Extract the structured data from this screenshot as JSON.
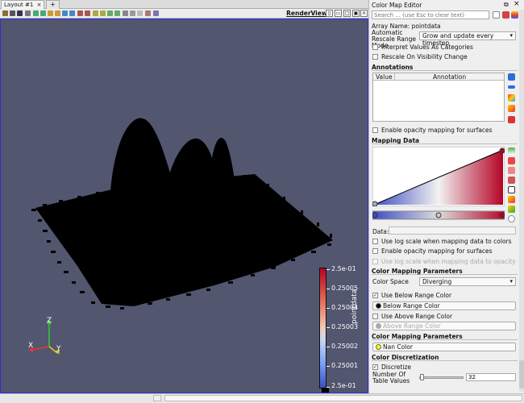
{
  "layout_tab": {
    "label": "Layout #1",
    "add_label": "+"
  },
  "view": {
    "title": "RenderView1",
    "background": "#52566f"
  },
  "colorbar": {
    "title": "pointdata",
    "labels": [
      "2.5e-01",
      "0.25005",
      "0.25004",
      "0.25003",
      "0.25002",
      "0.25001",
      "2.5e-01"
    ]
  },
  "axes": {
    "z": "Z",
    "x": "X",
    "y": "Y"
  },
  "panel": {
    "title": "Color Map Editor",
    "search_placeholder": "Search ... (use Esc to clear text)",
    "array_name": "Array Name: pointdata",
    "auto_rescale_label": "Automatic Rescale Range Mode",
    "auto_rescale_value": "Grow and update every timestep",
    "interpret_categories": "Interpret Values As Categories",
    "rescale_visibility": "Rescale On Visibility Change",
    "annotations_header": "Annotations",
    "annot_col_value": "Value",
    "annot_col_annotation": "Annotation",
    "enable_opacity_surfaces_1": "Enable opacity mapping for surfaces",
    "mapping_data_header": "Mapping Data",
    "data_label": "Data:",
    "log_scale_colors": "Use log scale when mapping data to colors",
    "enable_opacity_surfaces_2": "Enable opacity mapping for surfaces",
    "log_scale_opacity": "Use log scale when mapping data to opacity",
    "color_mapping_params_1": "Color Mapping Parameters",
    "color_space_label": "Color Space",
    "color_space_value": "Diverging",
    "use_below_range": "Use Below Range Color",
    "below_range_btn": "Below Range Color",
    "use_above_range": "Use Above Range Color",
    "above_range_btn": "Above Range Color",
    "color_mapping_params_2": "Color Mapping Parameters",
    "nan_color_btn": "Nan Color",
    "color_discretization": "Color Discretization",
    "discretize": "Discretize",
    "num_table_values_label": "Number Of Table Values",
    "num_table_values": "32"
  },
  "colors": {
    "accent": "#2f2fd5",
    "nan": "#ffff00",
    "below": "#000000",
    "above": "#aaaaaa"
  }
}
